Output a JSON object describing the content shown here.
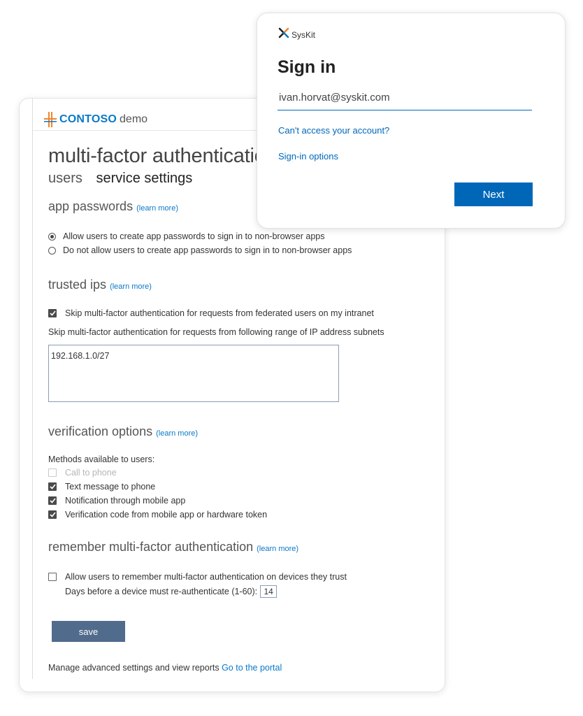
{
  "mfa": {
    "brand": {
      "name": "CONTOSO",
      "suffix": "demo"
    },
    "title": "multi-factor authentication",
    "tabs": {
      "users": "users",
      "service_settings": "service settings"
    },
    "learn_more": "(learn more)",
    "app_passwords": {
      "title": "app passwords",
      "options": [
        {
          "label": "Allow users to create app passwords to sign in to non-browser apps",
          "selected": true
        },
        {
          "label": "Do not allow users to create app passwords to sign in to non-browser apps",
          "selected": false
        }
      ]
    },
    "trusted_ips": {
      "title": "trusted ips",
      "skip_federated": {
        "label": "Skip multi-factor authentication for requests from federated users on my intranet",
        "checked": true
      },
      "subnet_label": "Skip multi-factor authentication for requests from following range of IP address subnets",
      "subnets": "192.168.1.0/27"
    },
    "verification": {
      "title": "verification options",
      "methods_label": "Methods available to users:",
      "methods": [
        {
          "label": "Call to phone",
          "checked": false,
          "disabled": true
        },
        {
          "label": "Text message to phone",
          "checked": true,
          "disabled": false
        },
        {
          "label": "Notification through mobile app",
          "checked": true,
          "disabled": false
        },
        {
          "label": "Verification code from mobile app or hardware token",
          "checked": true,
          "disabled": false
        }
      ]
    },
    "remember": {
      "title": "remember multi-factor authentication",
      "allow_label": "Allow users to remember multi-factor authentication on devices they trust",
      "allow_checked": false,
      "days_label": "Days before a device must re-authenticate (1-60):",
      "days_value": "14"
    },
    "save_label": "save",
    "footer": {
      "text": "Manage advanced settings and view reports",
      "link": "Go to the portal"
    }
  },
  "signin": {
    "brand": "SysKit",
    "title": "Sign in",
    "email": "ivan.horvat@syskit.com",
    "cant_access": "Can't access your account?",
    "options": "Sign-in options",
    "next": "Next"
  },
  "colors": {
    "contoso_blue": "#0a79c8",
    "ms_blue": "#0067b8",
    "save_button": "#506b8c"
  }
}
